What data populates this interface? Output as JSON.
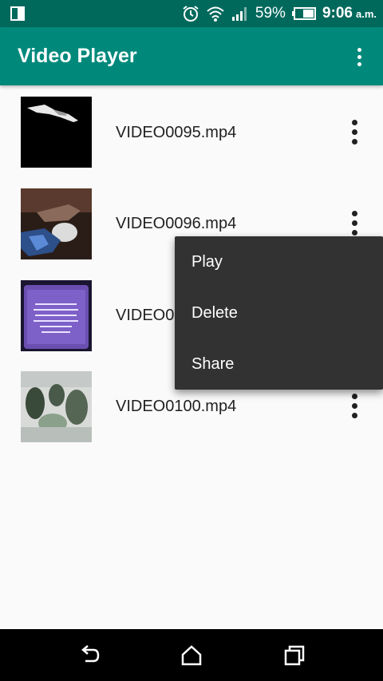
{
  "status_bar": {
    "battery_percent": "59%",
    "time": "9:06",
    "ampm": "a.m.",
    "icons": [
      "phone-layout-icon",
      "alarm-icon",
      "wifi-icon",
      "signal-icon",
      "battery-icon"
    ]
  },
  "app_bar": {
    "title": "Video Player",
    "overflow_icon": "more-vert-icon"
  },
  "videos": [
    {
      "filename": "VIDEO0095.mp4"
    },
    {
      "filename": "VIDEO0096.mp4"
    },
    {
      "filename": "VIDEO0"
    },
    {
      "filename": "VIDEO0100.mp4"
    }
  ],
  "popup_menu": {
    "items": [
      "Play",
      "Delete",
      "Share"
    ]
  },
  "nav_bar": {
    "icons": [
      "back-icon",
      "home-icon",
      "recents-icon"
    ]
  },
  "colors": {
    "status_bar": "#00695c",
    "app_bar": "#00897b",
    "background": "#fafafa",
    "popup": "#323232"
  }
}
